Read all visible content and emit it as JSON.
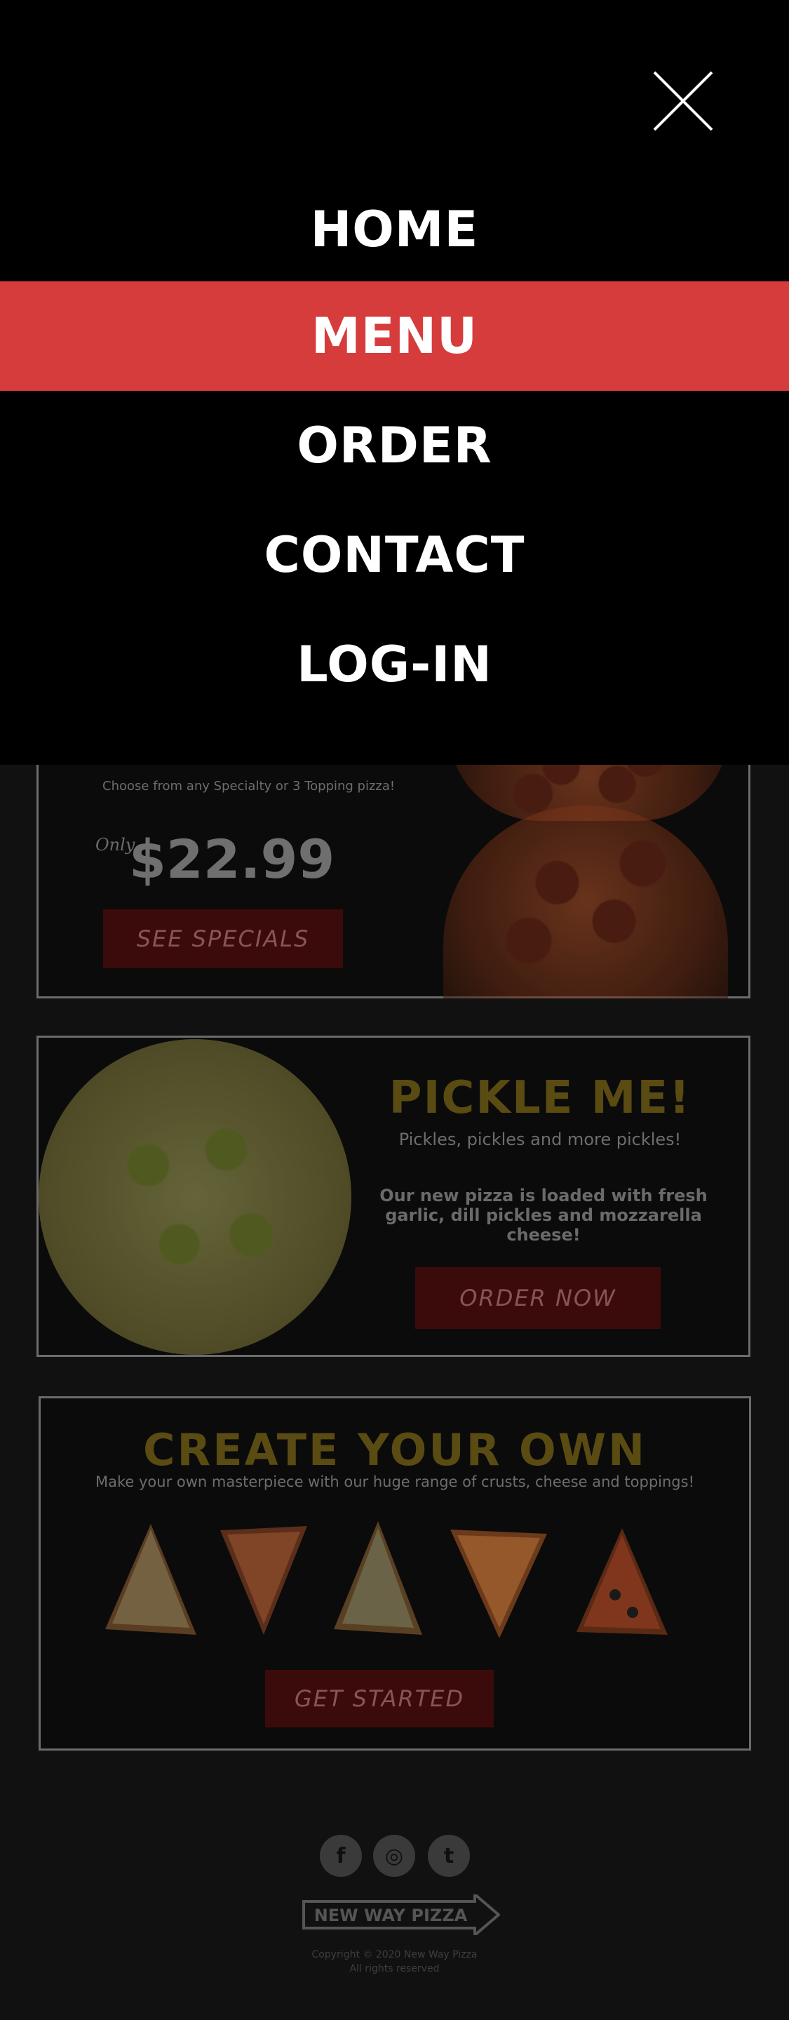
{
  "nav": {
    "items": [
      {
        "label": "HOME",
        "active": false
      },
      {
        "label": "MENU",
        "active": true
      },
      {
        "label": "ORDER",
        "active": false
      },
      {
        "label": "CONTACT",
        "active": false
      },
      {
        "label": "LOG-IN",
        "active": false
      }
    ],
    "close_icon": "close-icon",
    "active_color": "#d63c3c"
  },
  "specials": {
    "note": "Choose from any Specialty or 3 Topping pizza!",
    "only_label": "Only",
    "price": "$22.99",
    "button_label": "SEE SPECIALS"
  },
  "pickle": {
    "title": "PICKLE ME!",
    "subtitle": "Pickles, pickles and more pickles!",
    "description": "Our new pizza is loaded with fresh garlic, dill pickles and mozzarella cheese!",
    "button_label": "ORDER NOW"
  },
  "create": {
    "title": "CREATE YOUR OWN",
    "subtitle": "Make your own masterpiece with our huge range of crusts, cheese and toppings!",
    "button_label": "GET STARTED"
  },
  "footer": {
    "social": [
      {
        "icon": "facebook-icon",
        "glyph": "f"
      },
      {
        "icon": "instagram-icon",
        "glyph": "◎"
      },
      {
        "icon": "twitter-icon",
        "glyph": "t"
      }
    ],
    "logo_text": "NEW WAY PIZZA",
    "copyright": "Copyright © 2020 New Way Pizza",
    "rights": "All rights reserved"
  },
  "colors": {
    "accent_red": "#d63c3c",
    "dark_red_button": "#3b0b0b",
    "gold_title": "#5a4b12"
  }
}
